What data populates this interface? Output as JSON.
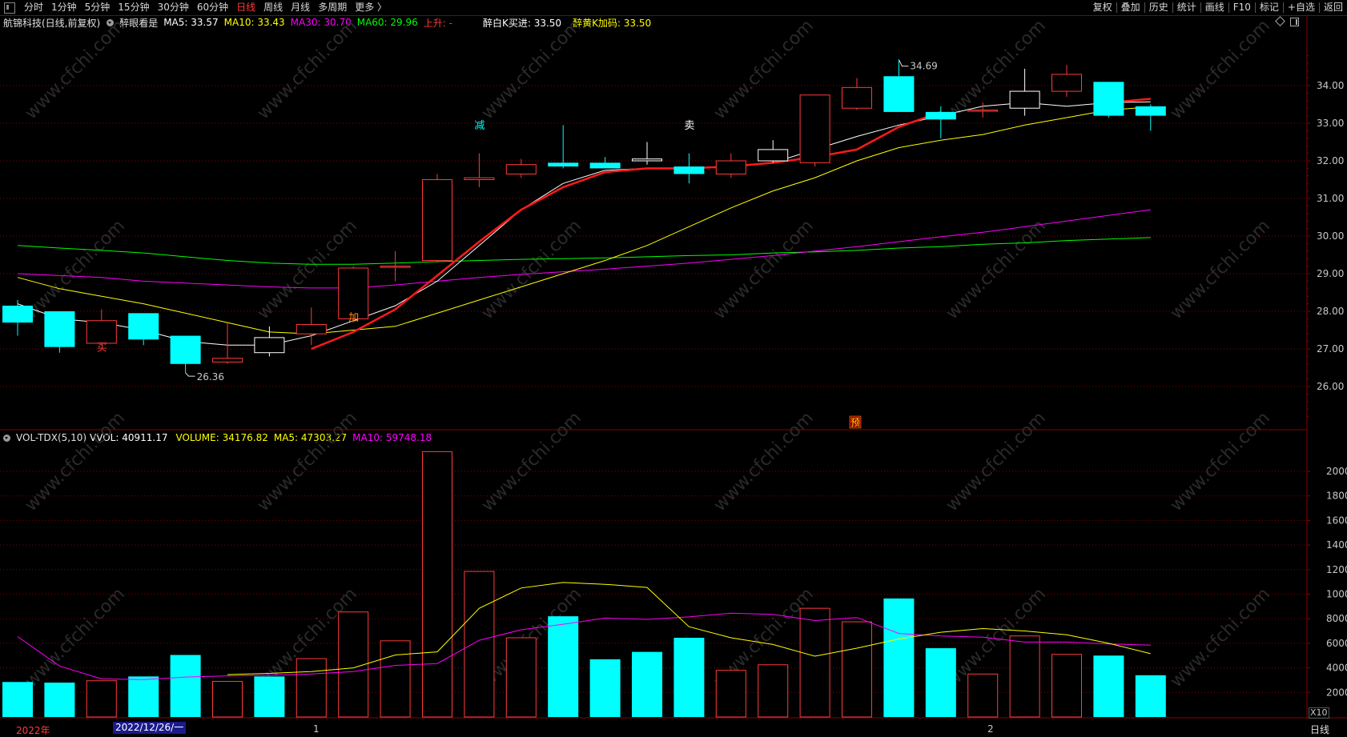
{
  "toolbar": {
    "left": [
      "分时",
      "1分钟",
      "5分钟",
      "15分钟",
      "30分钟",
      "60分钟",
      "日线",
      "周线",
      "月线",
      "多周期",
      "更多 〉"
    ],
    "active": "日线",
    "right": [
      "复权",
      "叠加",
      "历史",
      "统计",
      "画线",
      "F10",
      "标记",
      "+自选",
      "返回"
    ]
  },
  "header": {
    "stock": "航锦科技(日线,前复权)",
    "indicator": "醉眼看是",
    "ma5": "MA5: 33.57",
    "ma10": "MA10: 33.43",
    "ma30": "MA30: 30.70",
    "ma60": "MA60: 29.96",
    "rise": "上升: -",
    "buy_signal": "醉白K买进: 33.50",
    "add_signal": "醉黄K加码: 33.50"
  },
  "volume_header": {
    "name": "VOL-TDX(5,10)",
    "vvol": "VVOL: 40911.17",
    "volume": "VOLUME: 34176.82",
    "ma5": "MA5: 47303.27",
    "ma10": "MA10: 59748.18"
  },
  "colors": {
    "up": "#ff3b3b",
    "down": "#00ffff",
    "ma5": "#ffffff",
    "ma10": "#ffff00",
    "ma30": "#ff00ff",
    "ma60": "#00ff00",
    "grid": "#8b0000"
  },
  "watermark": "www.cfchi.com",
  "price_axis": {
    "ticks": [
      "34.00",
      "33.00",
      "32.00",
      "31.00",
      "30.00",
      "29.00",
      "28.00",
      "27.00",
      "26.00"
    ]
  },
  "volume_axis": {
    "ticks": [
      "20000",
      "18000",
      "16000",
      "14000",
      "12000",
      "10000",
      "8000",
      "6000",
      "4000",
      "2000"
    ],
    "unit": "X10"
  },
  "chart_data": {
    "type": "candlestick",
    "price_range": [
      25.0,
      35.0
    ],
    "candles": [
      {
        "o": 28.15,
        "h": 28.3,
        "l": 27.35,
        "c": 27.7
      },
      {
        "o": 28.0,
        "h": 28.0,
        "l": 26.9,
        "c": 27.05
      },
      {
        "o": 27.15,
        "h": 28.05,
        "l": 27.1,
        "c": 27.75
      },
      {
        "o": 27.95,
        "h": 27.95,
        "l": 27.1,
        "c": 27.25
      },
      {
        "o": 27.35,
        "h": 27.35,
        "l": 26.36,
        "c": 26.6
      },
      {
        "o": 26.65,
        "h": 27.7,
        "l": 26.6,
        "c": 26.75
      },
      {
        "o": 27.3,
        "h": 27.6,
        "l": 26.8,
        "c": 26.9
      },
      {
        "o": 27.4,
        "h": 28.1,
        "l": 27.1,
        "c": 27.65
      },
      {
        "o": 27.8,
        "h": 29.2,
        "l": 27.7,
        "c": 29.15
      },
      {
        "o": 29.2,
        "h": 29.6,
        "l": 28.8,
        "c": 29.2
      },
      {
        "o": 29.35,
        "h": 31.65,
        "l": 29.3,
        "c": 31.5
      },
      {
        "o": 31.5,
        "h": 32.2,
        "l": 31.3,
        "c": 31.55
      },
      {
        "o": 31.65,
        "h": 32.05,
        "l": 31.55,
        "c": 31.9
      },
      {
        "o": 31.95,
        "h": 32.95,
        "l": 31.8,
        "c": 31.85
      },
      {
        "o": 31.95,
        "h": 32.1,
        "l": 31.8,
        "c": 31.8
      },
      {
        "o": 32.05,
        "h": 32.5,
        "l": 31.9,
        "c": 32.0
      },
      {
        "o": 31.85,
        "h": 32.2,
        "l": 31.4,
        "c": 31.65
      },
      {
        "o": 31.65,
        "h": 32.2,
        "l": 31.55,
        "c": 32.0
      },
      {
        "o": 32.0,
        "h": 32.55,
        "l": 31.95,
        "c": 32.3
      },
      {
        "o": 31.95,
        "h": 33.75,
        "l": 31.85,
        "c": 33.75
      },
      {
        "o": 33.4,
        "h": 34.2,
        "l": 33.35,
        "c": 33.95
      },
      {
        "o": 34.25,
        "h": 34.69,
        "l": 33.3,
        "c": 33.3
      },
      {
        "o": 33.3,
        "h": 33.45,
        "l": 32.6,
        "c": 33.1
      },
      {
        "o": 33.35,
        "h": 33.55,
        "l": 33.15,
        "c": 33.35
      },
      {
        "o": 33.4,
        "h": 34.45,
        "l": 33.2,
        "c": 33.85
      },
      {
        "o": 33.85,
        "h": 34.55,
        "l": 33.7,
        "c": 34.3
      },
      {
        "o": 34.1,
        "h": 34.1,
        "l": 33.15,
        "c": 33.2
      },
      {
        "o": 33.45,
        "h": 33.5,
        "l": 32.8,
        "c": 33.2
      }
    ],
    "hollow_white": [
      6,
      15,
      18,
      24
    ],
    "ma5": [
      28.2,
      27.8,
      27.7,
      27.5,
      27.2,
      27.1,
      27.1,
      27.35,
      27.75,
      28.15,
      28.8,
      29.75,
      30.7,
      31.4,
      31.75,
      31.8,
      31.8,
      31.85,
      31.95,
      32.3,
      32.65,
      32.95,
      33.2,
      33.45,
      33.55,
      33.45,
      33.55,
      33.57
    ],
    "ma10": [
      28.9,
      28.6,
      28.4,
      28.2,
      27.95,
      27.7,
      27.45,
      27.4,
      27.5,
      27.6,
      27.95,
      28.3,
      28.65,
      29.0,
      29.35,
      29.75,
      30.25,
      30.75,
      31.2,
      31.55,
      32.0,
      32.35,
      32.55,
      32.7,
      32.95,
      33.15,
      33.35,
      33.43
    ],
    "ma30": [
      29.0,
      28.95,
      28.9,
      28.8,
      28.75,
      28.7,
      28.65,
      28.62,
      28.62,
      28.7,
      28.8,
      28.9,
      28.98,
      29.05,
      29.12,
      29.2,
      29.28,
      29.38,
      29.48,
      29.6,
      29.72,
      29.85,
      29.98,
      30.1,
      30.25,
      30.4,
      30.55,
      30.7
    ],
    "ma60": [
      29.75,
      29.68,
      29.62,
      29.55,
      29.45,
      29.35,
      29.28,
      29.25,
      29.25,
      29.28,
      29.32,
      29.35,
      29.38,
      29.4,
      29.42,
      29.45,
      29.48,
      29.5,
      29.55,
      29.58,
      29.62,
      29.68,
      29.72,
      29.78,
      29.82,
      29.88,
      29.92,
      29.96
    ],
    "red_line": {
      "from": 7,
      "values": [
        27.0,
        27.45,
        28.05,
        28.95,
        29.85,
        30.7,
        31.3,
        31.7,
        31.8,
        31.8,
        31.85,
        31.95,
        32.1,
        32.3,
        32.9,
        33.3,
        null,
        null,
        null,
        33.55,
        33.65
      ]
    },
    "annotations": [
      {
        "i": 2,
        "text": "买",
        "price": 26.95,
        "color": "#ff3b3b"
      },
      {
        "i": 8,
        "text": "加",
        "price": 27.75,
        "color": "#ff8c00"
      },
      {
        "i": 11,
        "text": "减",
        "price": 32.85,
        "color": "#00ffff"
      },
      {
        "i": 16,
        "text": "卖",
        "price": 32.85,
        "color": "#ffffff"
      }
    ],
    "high_label": "34.69",
    "low_label": "26.36",
    "volumes": [
      2850,
      2800,
      2950,
      3300,
      5050,
      2900,
      3300,
      4750,
      8550,
      6200,
      21600,
      11850,
      6450,
      8200,
      4700,
      5300,
      6450,
      3800,
      4250,
      8850,
      7750,
      9650,
      5600,
      3500,
      6600,
      5100,
      5000,
      3400
    ],
    "vol_ma5": [
      null,
      null,
      null,
      null,
      null,
      3450,
      3550,
      3700,
      4000,
      5050,
      5300,
      8850,
      10500,
      10950,
      10800,
      10550,
      7350,
      6450,
      5900,
      4950,
      5600,
      6350,
      6900,
      7200,
      7000,
      6700,
      6000,
      5150
    ],
    "vol_ma10": [
      6550,
      4150,
      3100,
      3050,
      3250,
      3350,
      3400,
      3500,
      3700,
      4200,
      4350,
      6250,
      7100,
      7550,
      8050,
      7950,
      8150,
      8450,
      8350,
      7850,
      8100,
      6800,
      6600,
      6500,
      6100,
      6100,
      5950,
      5850
    ],
    "date_labels": [
      "2022年",
      "2022/12/26/一",
      "1",
      "2"
    ],
    "period": "日线",
    "tag": "预"
  }
}
